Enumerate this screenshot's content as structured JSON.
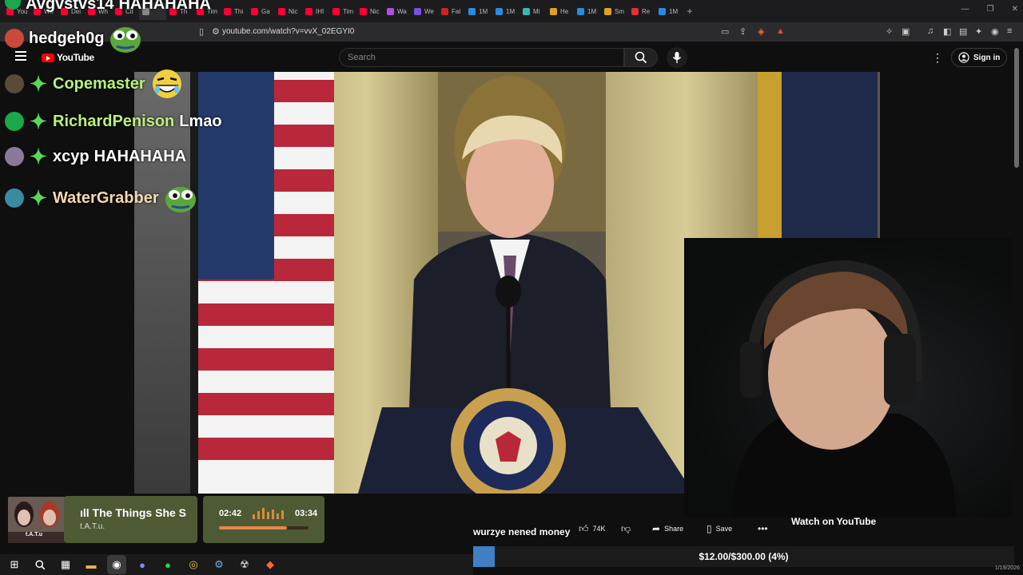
{
  "browser": {
    "tabs": [
      {
        "label": "You",
        "color": "#f03"
      },
      {
        "label": "Wo",
        "color": "#f03"
      },
      {
        "label": "Dei",
        "color": "#f03"
      },
      {
        "label": "Wh",
        "color": "#f03"
      },
      {
        "label": "Cit",
        "color": "#f03"
      },
      {
        "label": "",
        "color": "#888",
        "active": true
      },
      {
        "label": "Th",
        "color": "#f03"
      },
      {
        "label": "Tim",
        "color": "#f03"
      },
      {
        "label": "Thi",
        "color": "#f03"
      },
      {
        "label": "Ga",
        "color": "#f03"
      },
      {
        "label": "Nic",
        "color": "#f03"
      },
      {
        "label": "IHI",
        "color": "#f03"
      },
      {
        "label": "Tim",
        "color": "#f03"
      },
      {
        "label": "Nic",
        "color": "#f03"
      },
      {
        "label": "Wa",
        "color": "#b04ee0"
      },
      {
        "label": "We",
        "color": "#7a4ee0"
      },
      {
        "label": "Fal",
        "color": "#c22"
      },
      {
        "label": "1M",
        "color": "#2a8ae0"
      },
      {
        "label": "1M",
        "color": "#2a8ae0"
      },
      {
        "label": "Mi",
        "color": "#3ab8a8"
      },
      {
        "label": "He",
        "color": "#e0a020"
      },
      {
        "label": "1M",
        "color": "#2a8ae0"
      },
      {
        "label": "Sm",
        "color": "#e0a020"
      },
      {
        "label": "Re",
        "color": "#d33"
      },
      {
        "label": "1M",
        "color": "#2a8ae0"
      }
    ],
    "url": "youtube.com/watch?v=vvX_02EGYI0"
  },
  "youtube": {
    "logo_text": "YouTube",
    "search_placeholder": "Search",
    "signin_label": "Sign in",
    "actions": {
      "likes": "74K",
      "share": "Share",
      "save": "Save"
    },
    "watch_on": "Watch on YouTube"
  },
  "chat": {
    "top_partial": {
      "user": "Avgvstvs14",
      "message": "HAHAHAHA"
    },
    "messages": [
      {
        "user": "hedgeh0g",
        "message": "",
        "user_color": "#ffffff",
        "avatar_color": "#c94a3a",
        "emote": "pepe"
      },
      {
        "user": "Copemaster",
        "message": "",
        "user_color": "#b8f07a",
        "avatar_color": "#5a4a3a",
        "emote": "laugh"
      },
      {
        "user": "RichardPenison",
        "message": "Lmao",
        "user_color": "#b8f07a",
        "avatar_color": "#1aa84a",
        "emote": ""
      },
      {
        "user": "xcyp",
        "message": "HAHAHAHA",
        "user_color": "#ffffff",
        "avatar_color": "#8a7a9a",
        "emote": ""
      },
      {
        "user": "WaterGrabber",
        "message": "",
        "user_color": "#f5d7b0",
        "avatar_color": "#3a8aa0",
        "emote": "pepe"
      }
    ]
  },
  "music": {
    "title": "All The Things She Said",
    "title_visible": "ıll The Things She S",
    "artist": "t.A.T.u.",
    "elapsed": "02:42",
    "total": "03:34",
    "progress": 0.76,
    "album_text": "t.A.T.u"
  },
  "alert": {
    "text": "wurzye nened money"
  },
  "goal": {
    "text": "$12.00/$300.00 (4%)",
    "progress": 0.04
  },
  "clock": "1/19/2026",
  "colors": {
    "accent_green": "#5ad75a",
    "music_bg": "#4d5a34",
    "goal_fill": "#3f7fc4"
  }
}
